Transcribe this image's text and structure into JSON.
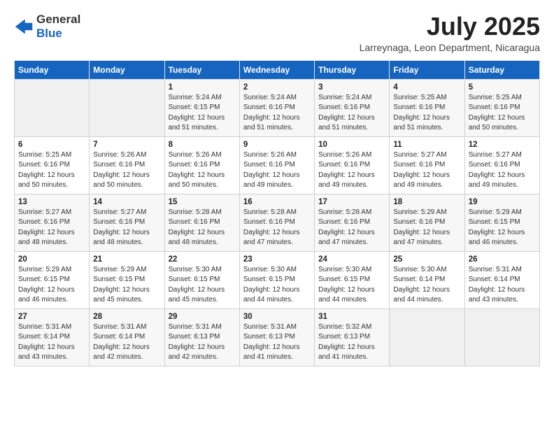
{
  "logo": {
    "general": "General",
    "blue": "Blue"
  },
  "header": {
    "month": "July 2025",
    "location": "Larreynaga, Leon Department, Nicaragua"
  },
  "weekdays": [
    "Sunday",
    "Monday",
    "Tuesday",
    "Wednesday",
    "Thursday",
    "Friday",
    "Saturday"
  ],
  "weeks": [
    [
      {
        "day": "",
        "sunrise": "",
        "sunset": "",
        "daylight": ""
      },
      {
        "day": "",
        "sunrise": "",
        "sunset": "",
        "daylight": ""
      },
      {
        "day": "1",
        "sunrise": "Sunrise: 5:24 AM",
        "sunset": "Sunset: 6:15 PM",
        "daylight": "Daylight: 12 hours and 51 minutes."
      },
      {
        "day": "2",
        "sunrise": "Sunrise: 5:24 AM",
        "sunset": "Sunset: 6:16 PM",
        "daylight": "Daylight: 12 hours and 51 minutes."
      },
      {
        "day": "3",
        "sunrise": "Sunrise: 5:24 AM",
        "sunset": "Sunset: 6:16 PM",
        "daylight": "Daylight: 12 hours and 51 minutes."
      },
      {
        "day": "4",
        "sunrise": "Sunrise: 5:25 AM",
        "sunset": "Sunset: 6:16 PM",
        "daylight": "Daylight: 12 hours and 51 minutes."
      },
      {
        "day": "5",
        "sunrise": "Sunrise: 5:25 AM",
        "sunset": "Sunset: 6:16 PM",
        "daylight": "Daylight: 12 hours and 50 minutes."
      }
    ],
    [
      {
        "day": "6",
        "sunrise": "Sunrise: 5:25 AM",
        "sunset": "Sunset: 6:16 PM",
        "daylight": "Daylight: 12 hours and 50 minutes."
      },
      {
        "day": "7",
        "sunrise": "Sunrise: 5:26 AM",
        "sunset": "Sunset: 6:16 PM",
        "daylight": "Daylight: 12 hours and 50 minutes."
      },
      {
        "day": "8",
        "sunrise": "Sunrise: 5:26 AM",
        "sunset": "Sunset: 6:16 PM",
        "daylight": "Daylight: 12 hours and 50 minutes."
      },
      {
        "day": "9",
        "sunrise": "Sunrise: 5:26 AM",
        "sunset": "Sunset: 6:16 PM",
        "daylight": "Daylight: 12 hours and 49 minutes."
      },
      {
        "day": "10",
        "sunrise": "Sunrise: 5:26 AM",
        "sunset": "Sunset: 6:16 PM",
        "daylight": "Daylight: 12 hours and 49 minutes."
      },
      {
        "day": "11",
        "sunrise": "Sunrise: 5:27 AM",
        "sunset": "Sunset: 6:16 PM",
        "daylight": "Daylight: 12 hours and 49 minutes."
      },
      {
        "day": "12",
        "sunrise": "Sunrise: 5:27 AM",
        "sunset": "Sunset: 6:16 PM",
        "daylight": "Daylight: 12 hours and 49 minutes."
      }
    ],
    [
      {
        "day": "13",
        "sunrise": "Sunrise: 5:27 AM",
        "sunset": "Sunset: 6:16 PM",
        "daylight": "Daylight: 12 hours and 48 minutes."
      },
      {
        "day": "14",
        "sunrise": "Sunrise: 5:27 AM",
        "sunset": "Sunset: 6:16 PM",
        "daylight": "Daylight: 12 hours and 48 minutes."
      },
      {
        "day": "15",
        "sunrise": "Sunrise: 5:28 AM",
        "sunset": "Sunset: 6:16 PM",
        "daylight": "Daylight: 12 hours and 48 minutes."
      },
      {
        "day": "16",
        "sunrise": "Sunrise: 5:28 AM",
        "sunset": "Sunset: 6:16 PM",
        "daylight": "Daylight: 12 hours and 47 minutes."
      },
      {
        "day": "17",
        "sunrise": "Sunrise: 5:28 AM",
        "sunset": "Sunset: 6:16 PM",
        "daylight": "Daylight: 12 hours and 47 minutes."
      },
      {
        "day": "18",
        "sunrise": "Sunrise: 5:29 AM",
        "sunset": "Sunset: 6:16 PM",
        "daylight": "Daylight: 12 hours and 47 minutes."
      },
      {
        "day": "19",
        "sunrise": "Sunrise: 5:29 AM",
        "sunset": "Sunset: 6:15 PM",
        "daylight": "Daylight: 12 hours and 46 minutes."
      }
    ],
    [
      {
        "day": "20",
        "sunrise": "Sunrise: 5:29 AM",
        "sunset": "Sunset: 6:15 PM",
        "daylight": "Daylight: 12 hours and 46 minutes."
      },
      {
        "day": "21",
        "sunrise": "Sunrise: 5:29 AM",
        "sunset": "Sunset: 6:15 PM",
        "daylight": "Daylight: 12 hours and 45 minutes."
      },
      {
        "day": "22",
        "sunrise": "Sunrise: 5:30 AM",
        "sunset": "Sunset: 6:15 PM",
        "daylight": "Daylight: 12 hours and 45 minutes."
      },
      {
        "day": "23",
        "sunrise": "Sunrise: 5:30 AM",
        "sunset": "Sunset: 6:15 PM",
        "daylight": "Daylight: 12 hours and 44 minutes."
      },
      {
        "day": "24",
        "sunrise": "Sunrise: 5:30 AM",
        "sunset": "Sunset: 6:15 PM",
        "daylight": "Daylight: 12 hours and 44 minutes."
      },
      {
        "day": "25",
        "sunrise": "Sunrise: 5:30 AM",
        "sunset": "Sunset: 6:14 PM",
        "daylight": "Daylight: 12 hours and 44 minutes."
      },
      {
        "day": "26",
        "sunrise": "Sunrise: 5:31 AM",
        "sunset": "Sunset: 6:14 PM",
        "daylight": "Daylight: 12 hours and 43 minutes."
      }
    ],
    [
      {
        "day": "27",
        "sunrise": "Sunrise: 5:31 AM",
        "sunset": "Sunset: 6:14 PM",
        "daylight": "Daylight: 12 hours and 43 minutes."
      },
      {
        "day": "28",
        "sunrise": "Sunrise: 5:31 AM",
        "sunset": "Sunset: 6:14 PM",
        "daylight": "Daylight: 12 hours and 42 minutes."
      },
      {
        "day": "29",
        "sunrise": "Sunrise: 5:31 AM",
        "sunset": "Sunset: 6:13 PM",
        "daylight": "Daylight: 12 hours and 42 minutes."
      },
      {
        "day": "30",
        "sunrise": "Sunrise: 5:31 AM",
        "sunset": "Sunset: 6:13 PM",
        "daylight": "Daylight: 12 hours and 41 minutes."
      },
      {
        "day": "31",
        "sunrise": "Sunrise: 5:32 AM",
        "sunset": "Sunset: 6:13 PM",
        "daylight": "Daylight: 12 hours and 41 minutes."
      },
      {
        "day": "",
        "sunrise": "",
        "sunset": "",
        "daylight": ""
      },
      {
        "day": "",
        "sunrise": "",
        "sunset": "",
        "daylight": ""
      }
    ]
  ]
}
